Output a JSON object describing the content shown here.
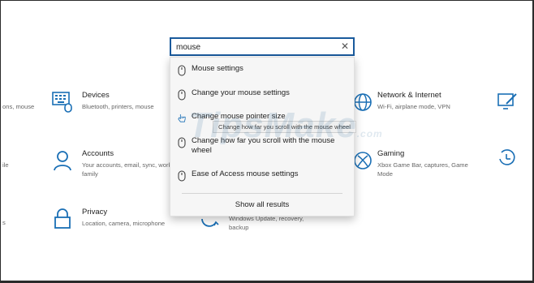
{
  "search": {
    "value": "mouse",
    "close_glyph": "✕"
  },
  "results": [
    {
      "label": "Mouse settings",
      "icon": "mouse-icon"
    },
    {
      "label": "Change your mouse settings",
      "icon": "mouse-icon"
    },
    {
      "label": "Change mouse pointer size",
      "icon": "pointer-hand-icon"
    },
    {
      "label": "Change how far you scroll with the mouse wheel",
      "icon": "mouse-icon"
    },
    {
      "label": "Ease of Access mouse settings",
      "icon": "mouse-icon"
    }
  ],
  "show_all": "Show all results",
  "tooltip": "Change how far you scroll with the mouse wheel",
  "watermark": {
    "main": "TipsMake",
    "suffix": ".com"
  },
  "tiles": {
    "devices": {
      "title": "Devices",
      "desc": "Bluetooth, printers, mouse"
    },
    "accounts": {
      "title": "Accounts",
      "desc": "Your accounts, email, sync, work, family"
    },
    "privacy": {
      "title": "Privacy",
      "desc": "Location, camera, microphone"
    },
    "network": {
      "title": "Network & Internet",
      "desc": "Wi-Fi, airplane mode, VPN"
    },
    "gaming": {
      "title": "Gaming",
      "desc": "Xbox Game Bar, captures, Game Mode"
    },
    "update": {
      "desc": "Windows Update, recovery, backup"
    }
  },
  "edge": {
    "left1": "ons, mouse",
    "left2": "ile",
    "left3": "s"
  }
}
